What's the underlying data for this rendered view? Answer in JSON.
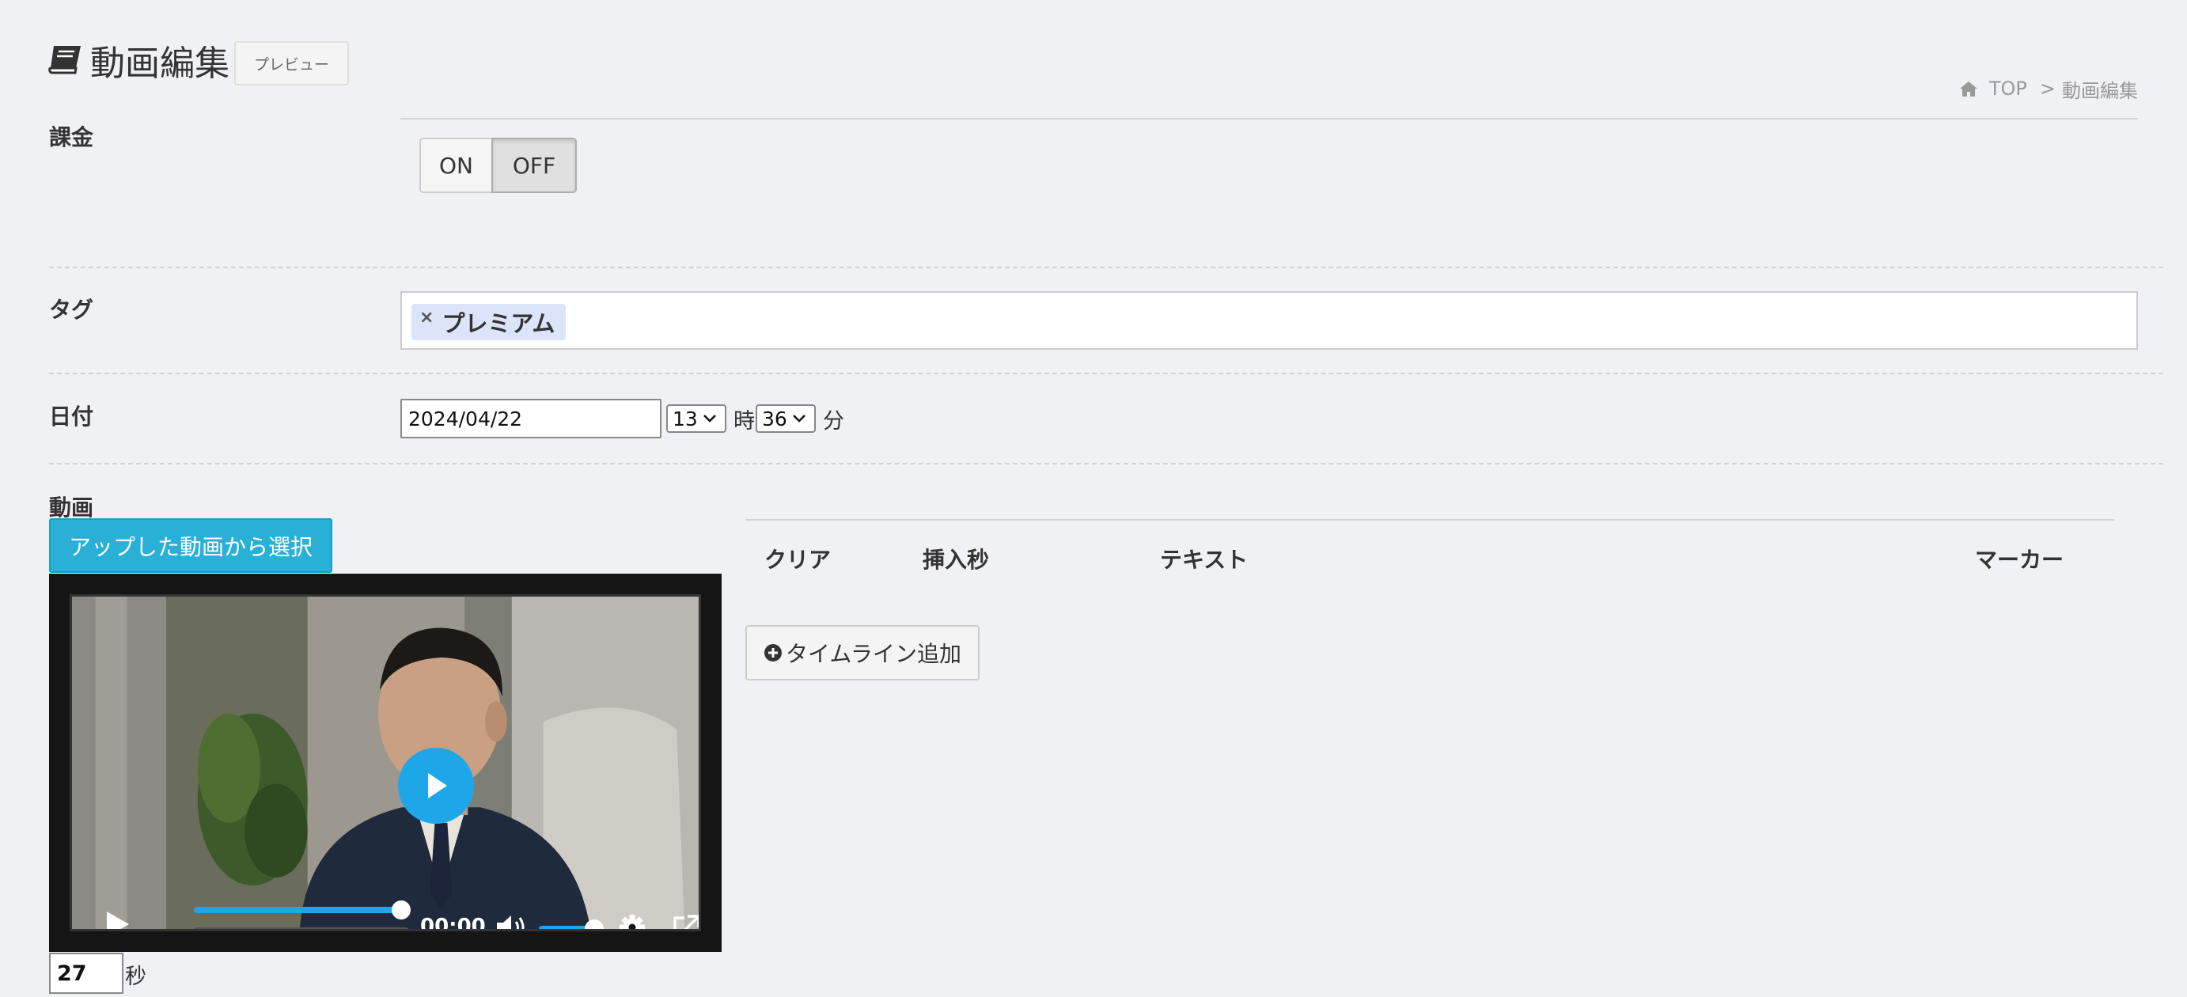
{
  "header": {
    "title": "動画編集",
    "preview_label": "プレビュー"
  },
  "breadcrumb": {
    "home_label": "TOP",
    "separator": ">",
    "current": "動画編集"
  },
  "billing": {
    "label": "課金",
    "on_label": "ON",
    "off_label": "OFF",
    "selected": "OFF"
  },
  "tags": {
    "label": "タグ",
    "items": [
      {
        "text": "プレミアム",
        "remove": "×"
      }
    ]
  },
  "date": {
    "label": "日付",
    "value": "2024/04/22",
    "hour": "13",
    "hour_unit": "時",
    "minute": "36",
    "minute_unit": "分"
  },
  "video": {
    "label": "動画",
    "select_button": "アップした動画から選択",
    "current_time": "00:00",
    "seconds_value": "27",
    "seconds_unit": "秒",
    "accent_color": "#1ea7e8"
  },
  "timeline": {
    "columns": [
      "クリア",
      "挿入秒",
      "テキスト",
      "マーカー"
    ],
    "add_button": "タイムライン追加"
  }
}
